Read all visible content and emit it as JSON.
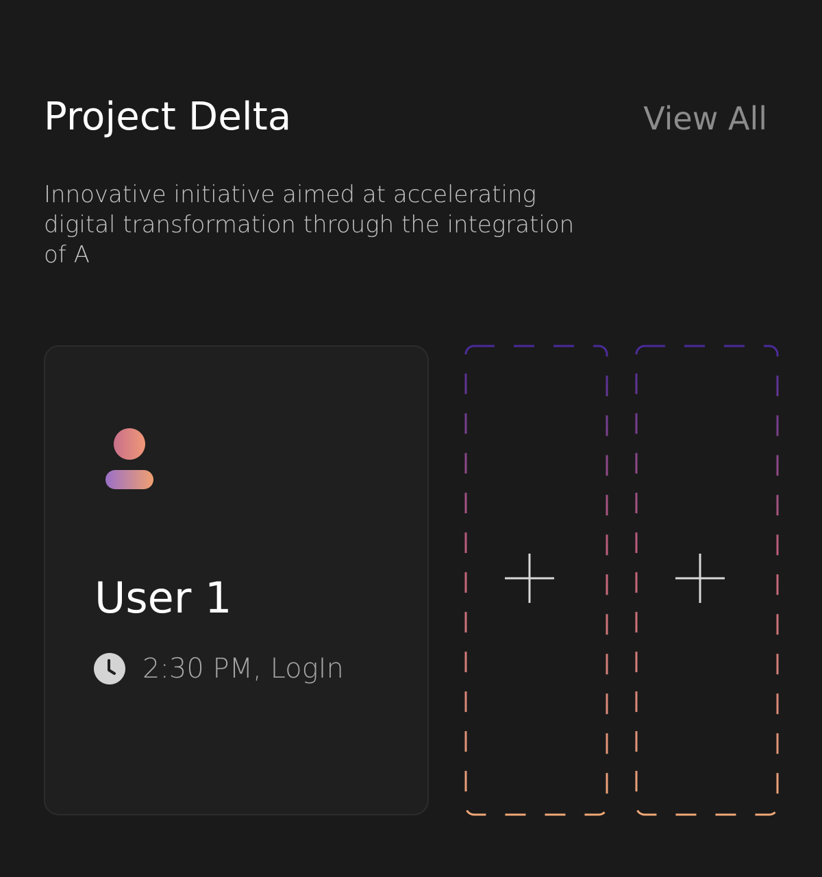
{
  "header": {
    "title": "Project Delta",
    "view_all_label": "View All"
  },
  "description": "Innovative initiative aimed at accelerating digital transformation through the integration of A",
  "user_card": {
    "name": "User 1",
    "time_status": "2:30 PM, LogIn",
    "avatar_icon": "user-avatar-icon",
    "clock_icon": "clock-icon"
  },
  "add_slots": [
    {
      "icon": "plus-icon"
    },
    {
      "icon": "plus-icon"
    }
  ],
  "colors": {
    "background": "#1a1a1a",
    "card_background": "#1f1f1f",
    "gradient_start": "#4a2a9a",
    "gradient_mid": "#c0607a",
    "gradient_end": "#f0a070"
  }
}
